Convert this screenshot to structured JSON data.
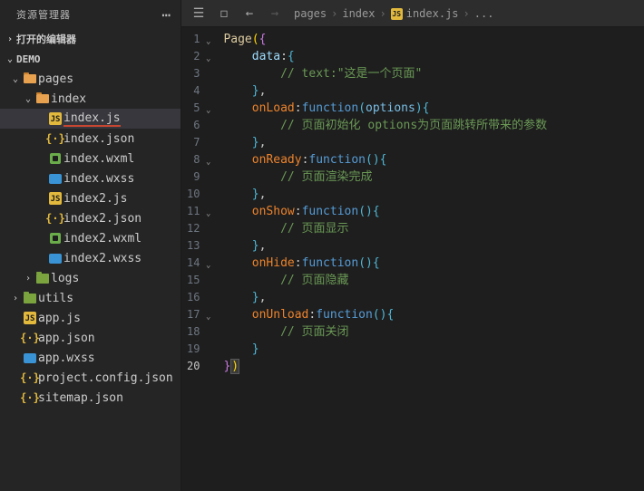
{
  "sidebar": {
    "title": "资源管理器",
    "sections": {
      "openEditors": "打开的编辑器",
      "project": "DEMO"
    },
    "tree": [
      {
        "name": "pages",
        "indent": 0,
        "type": "folder-open",
        "expanded": true,
        "chev": "down"
      },
      {
        "name": "index",
        "indent": 1,
        "type": "folder-open",
        "expanded": true,
        "chev": "down"
      },
      {
        "name": "index.js",
        "indent": 2,
        "type": "js",
        "active": true,
        "underline": true
      },
      {
        "name": "index.json",
        "indent": 2,
        "type": "json"
      },
      {
        "name": "index.wxml",
        "indent": 2,
        "type": "wxml"
      },
      {
        "name": "index.wxss",
        "indent": 2,
        "type": "wxss"
      },
      {
        "name": "index2.js",
        "indent": 2,
        "type": "js"
      },
      {
        "name": "index2.json",
        "indent": 2,
        "type": "json"
      },
      {
        "name": "index2.wxml",
        "indent": 2,
        "type": "wxml"
      },
      {
        "name": "index2.wxss",
        "indent": 2,
        "type": "wxss"
      },
      {
        "name": "logs",
        "indent": 1,
        "type": "folder-green",
        "chev": "right"
      },
      {
        "name": "utils",
        "indent": 0,
        "type": "folder-green",
        "chev": "right"
      },
      {
        "name": "app.js",
        "indent": 0,
        "type": "js"
      },
      {
        "name": "app.json",
        "indent": 0,
        "type": "json"
      },
      {
        "name": "app.wxss",
        "indent": 0,
        "type": "wxss"
      },
      {
        "name": "project.config.json",
        "indent": 0,
        "type": "json"
      },
      {
        "name": "sitemap.json",
        "indent": 0,
        "type": "json"
      }
    ]
  },
  "breadcrumb": {
    "parts": [
      "pages",
      "index",
      "index.js",
      "..."
    ],
    "fileIcon": "js"
  },
  "code": {
    "lines": [
      {
        "n": 1,
        "fold": "down",
        "tokens": [
          [
            "c-obj",
            "Page"
          ],
          [
            "c-bracket-y",
            "("
          ],
          [
            "c-bracket-p",
            "{"
          ]
        ]
      },
      {
        "n": 2,
        "fold": "down",
        "tokens": [
          [
            "",
            "    "
          ],
          [
            "c-prop",
            "data"
          ],
          [
            "c-punc",
            ":"
          ],
          [
            "c-bracket-b",
            "{"
          ]
        ]
      },
      {
        "n": 3,
        "tokens": [
          [
            "",
            "        "
          ],
          [
            "c-comment",
            "// text:\"这是一个页面\""
          ]
        ]
      },
      {
        "n": 4,
        "tokens": [
          [
            "",
            "    "
          ],
          [
            "c-bracket-b",
            "}"
          ],
          [
            "c-punc",
            ","
          ]
        ]
      },
      {
        "n": 5,
        "fold": "down",
        "tokens": [
          [
            "",
            "    "
          ],
          [
            "c-func",
            "onLoad"
          ],
          [
            "c-punc",
            ":"
          ],
          [
            "c-kw",
            "function"
          ],
          [
            "c-bracket-b",
            "("
          ],
          [
            "c-param",
            "options"
          ],
          [
            "c-bracket-b",
            ")"
          ],
          [
            "c-bracket-b",
            "{"
          ]
        ]
      },
      {
        "n": 6,
        "tokens": [
          [
            "",
            "        "
          ],
          [
            "c-comment",
            "// 页面初始化 options为页面跳转所带来的参数"
          ]
        ]
      },
      {
        "n": 7,
        "tokens": [
          [
            "",
            "    "
          ],
          [
            "c-bracket-b",
            "}"
          ],
          [
            "c-punc",
            ","
          ]
        ]
      },
      {
        "n": 8,
        "fold": "down",
        "tokens": [
          [
            "",
            "    "
          ],
          [
            "c-func",
            "onReady"
          ],
          [
            "c-punc",
            ":"
          ],
          [
            "c-kw",
            "function"
          ],
          [
            "c-bracket-b",
            "()"
          ],
          [
            "c-bracket-b",
            "{"
          ]
        ]
      },
      {
        "n": 9,
        "tokens": [
          [
            "",
            "        "
          ],
          [
            "c-comment",
            "// 页面渲染完成"
          ]
        ]
      },
      {
        "n": 10,
        "tokens": [
          [
            "",
            "    "
          ],
          [
            "c-bracket-b",
            "}"
          ],
          [
            "c-punc",
            ","
          ]
        ]
      },
      {
        "n": 11,
        "fold": "down",
        "tokens": [
          [
            "",
            "    "
          ],
          [
            "c-func",
            "onShow"
          ],
          [
            "c-punc",
            ":"
          ],
          [
            "c-kw",
            "function"
          ],
          [
            "c-bracket-b",
            "()"
          ],
          [
            "c-bracket-b",
            "{"
          ]
        ]
      },
      {
        "n": 12,
        "tokens": [
          [
            "",
            "        "
          ],
          [
            "c-comment",
            "// 页面显示"
          ]
        ]
      },
      {
        "n": 13,
        "tokens": [
          [
            "",
            "    "
          ],
          [
            "c-bracket-b",
            "}"
          ],
          [
            "c-punc",
            ","
          ]
        ]
      },
      {
        "n": 14,
        "fold": "down",
        "tokens": [
          [
            "",
            "    "
          ],
          [
            "c-func",
            "onHide"
          ],
          [
            "c-punc",
            ":"
          ],
          [
            "c-kw",
            "function"
          ],
          [
            "c-bracket-b",
            "()"
          ],
          [
            "c-bracket-b",
            "{"
          ]
        ]
      },
      {
        "n": 15,
        "tokens": [
          [
            "",
            "        "
          ],
          [
            "c-comment",
            "// 页面隐藏"
          ]
        ]
      },
      {
        "n": 16,
        "tokens": [
          [
            "",
            "    "
          ],
          [
            "c-bracket-b",
            "}"
          ],
          [
            "c-punc",
            ","
          ]
        ]
      },
      {
        "n": 17,
        "fold": "down",
        "tokens": [
          [
            "",
            "    "
          ],
          [
            "c-func",
            "onUnload"
          ],
          [
            "c-punc",
            ":"
          ],
          [
            "c-kw",
            "function"
          ],
          [
            "c-bracket-b",
            "()"
          ],
          [
            "c-bracket-b",
            "{"
          ]
        ]
      },
      {
        "n": 18,
        "tokens": [
          [
            "",
            "        "
          ],
          [
            "c-comment",
            "// 页面关闭"
          ]
        ]
      },
      {
        "n": 19,
        "tokens": [
          [
            "",
            "    "
          ],
          [
            "c-bracket-b",
            "}"
          ]
        ]
      },
      {
        "n": 20,
        "hi": true,
        "last": true,
        "tokens": [
          [
            "c-bracket-p",
            "}"
          ],
          [
            "c-bracket-y cursor-box",
            ")"
          ]
        ]
      }
    ]
  }
}
